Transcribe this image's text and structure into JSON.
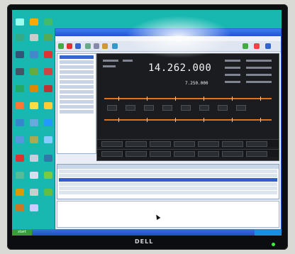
{
  "monitor": {
    "brand": "DELL"
  },
  "radio_display": {
    "main_frequency": "14.262.000",
    "sub_frequency": "7.250.000"
  },
  "taskbar": {
    "start_label": "start",
    "clock": ""
  }
}
